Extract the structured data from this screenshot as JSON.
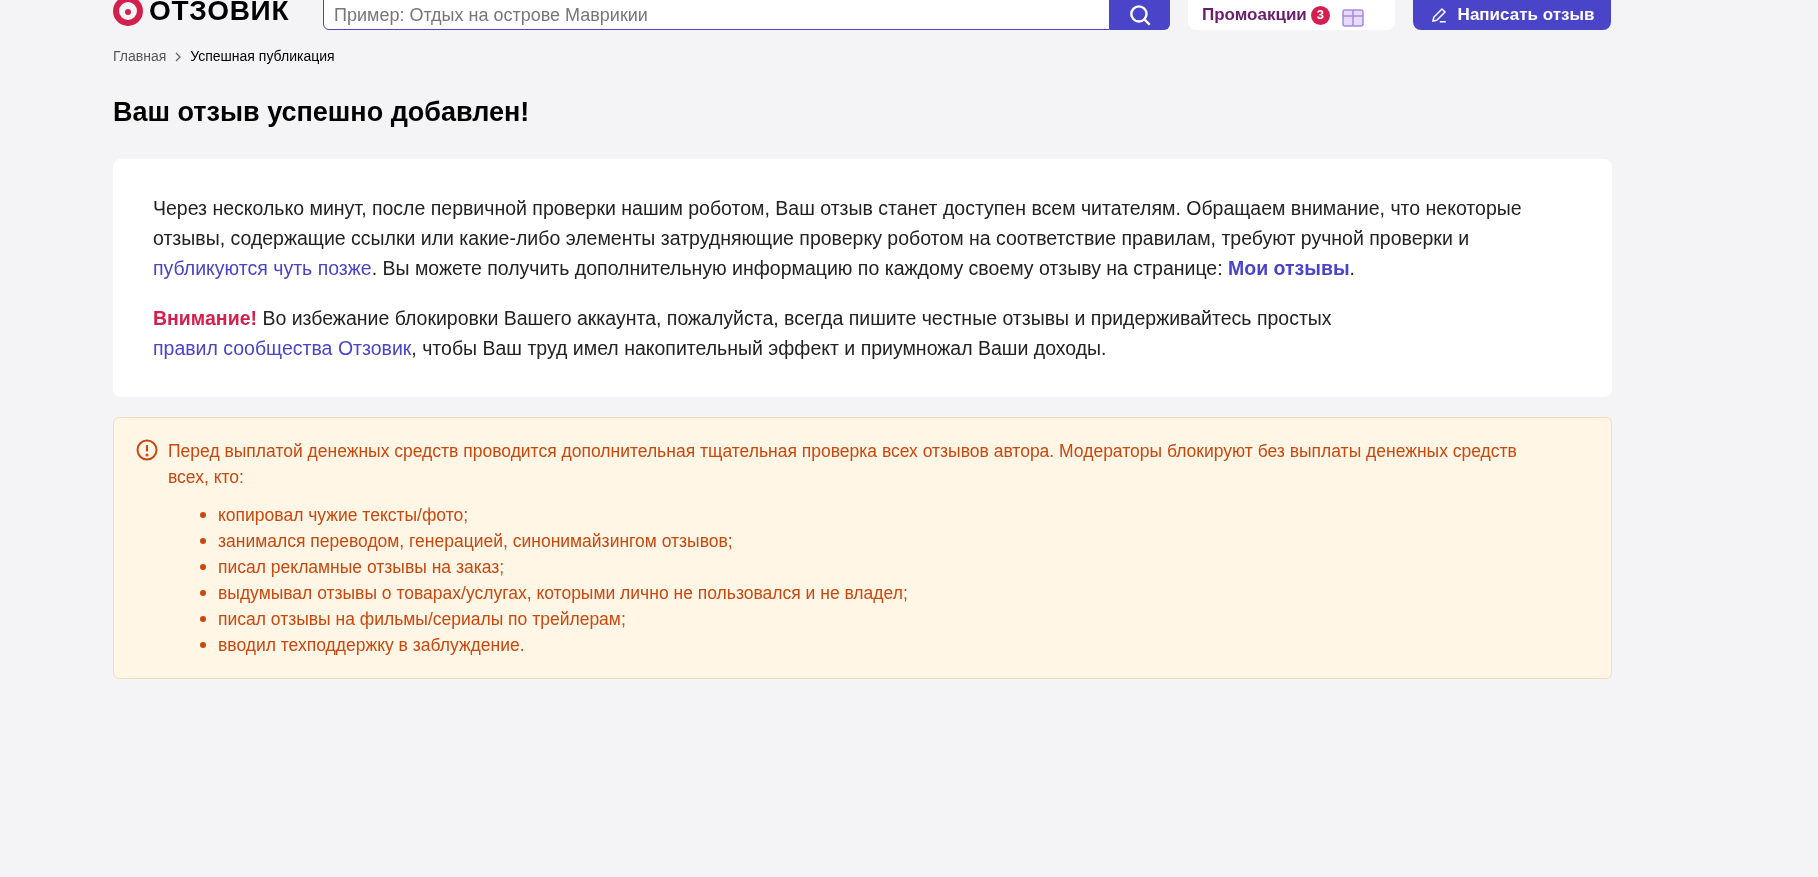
{
  "header": {
    "logo": "ОТЗОВИК",
    "search": {
      "placeholder": "Пример: Отдых на острове Маврикии"
    },
    "promo": {
      "label": "Промоакции",
      "count": "3"
    },
    "write_button": "Написать отзыв"
  },
  "breadcrumbs": [
    {
      "label": "Главная",
      "kind": "link"
    },
    {
      "label": "Успешная публикация",
      "kind": "current"
    }
  ],
  "title": "Ваш отзыв успешно добавлен!",
  "card": {
    "paragraphs": [
      [
        {
          "kind": "text",
          "text": "Через несколько минут, после первичной проверки нашим роботом, Ваш отзыв станет доступен всем читателям. Обращаем внимание, что некоторые отзывы, содержащие ссылки или какие-либо элементы затрудняющие проверку роботом на соответствие правилам, требуют ручной проверки и "
        },
        {
          "kind": "link",
          "text": "публикуются чуть позже"
        },
        {
          "kind": "text",
          "text": ". Вы можете получить дополнительную информацию по каждому своему отзыву на странице: "
        },
        {
          "kind": "strong_link",
          "text": "Мои отзывы"
        },
        {
          "kind": "text",
          "text": "."
        }
      ],
      [
        {
          "kind": "alert",
          "text": "Внимание!"
        },
        {
          "kind": "text",
          "text": " Во избежание блокировки Вашего аккаунта, пожалуйста, всегда пишите честные отзывы и придерживайтесь простых "
        },
        {
          "kind": "link",
          "text": "правил сообщества Отзовик"
        },
        {
          "kind": "text",
          "text": ", чтобы Ваш труд имел накопительный эффект и приумножал Ваши доходы."
        }
      ]
    ]
  },
  "warning": {
    "text": "Перед выплатой денежных средств проводится дополнительная тщательная проверка всех отзывов автора. Модераторы блокируют без выплаты денежных средств всех, кто:",
    "items": [
      "копировал чужие тексты/фото;",
      "занимался переводом, генерацией, синонимайзингом отзывов;",
      "писал рекламные отзывы на заказ;",
      "выдумывал отзывы о товарах/услугах, которыми лично не пользовался и не владел;",
      "писал отзывы на фильмы/сериалы по трейлерам;",
      "вводил техподдержку в заблуждение."
    ]
  }
}
